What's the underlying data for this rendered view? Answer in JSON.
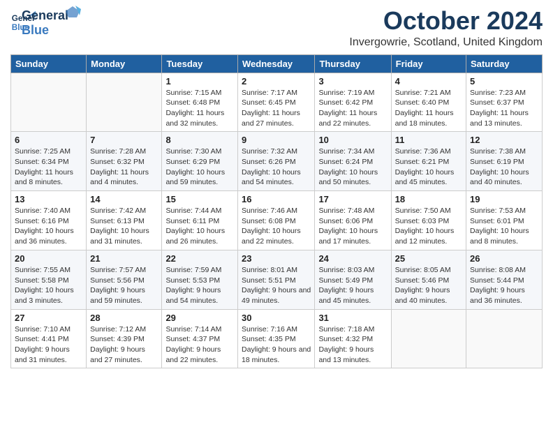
{
  "header": {
    "logo_line1": "General",
    "logo_line2": "Blue",
    "month_title": "October 2024",
    "location": "Invergowrie, Scotland, United Kingdom"
  },
  "weekdays": [
    "Sunday",
    "Monday",
    "Tuesday",
    "Wednesday",
    "Thursday",
    "Friday",
    "Saturday"
  ],
  "weeks": [
    [
      {
        "day": "",
        "info": ""
      },
      {
        "day": "",
        "info": ""
      },
      {
        "day": "1",
        "info": "Sunrise: 7:15 AM\nSunset: 6:48 PM\nDaylight: 11 hours and 32 minutes."
      },
      {
        "day": "2",
        "info": "Sunrise: 7:17 AM\nSunset: 6:45 PM\nDaylight: 11 hours and 27 minutes."
      },
      {
        "day": "3",
        "info": "Sunrise: 7:19 AM\nSunset: 6:42 PM\nDaylight: 11 hours and 22 minutes."
      },
      {
        "day": "4",
        "info": "Sunrise: 7:21 AM\nSunset: 6:40 PM\nDaylight: 11 hours and 18 minutes."
      },
      {
        "day": "5",
        "info": "Sunrise: 7:23 AM\nSunset: 6:37 PM\nDaylight: 11 hours and 13 minutes."
      }
    ],
    [
      {
        "day": "6",
        "info": "Sunrise: 7:25 AM\nSunset: 6:34 PM\nDaylight: 11 hours and 8 minutes."
      },
      {
        "day": "7",
        "info": "Sunrise: 7:28 AM\nSunset: 6:32 PM\nDaylight: 11 hours and 4 minutes."
      },
      {
        "day": "8",
        "info": "Sunrise: 7:30 AM\nSunset: 6:29 PM\nDaylight: 10 hours and 59 minutes."
      },
      {
        "day": "9",
        "info": "Sunrise: 7:32 AM\nSunset: 6:26 PM\nDaylight: 10 hours and 54 minutes."
      },
      {
        "day": "10",
        "info": "Sunrise: 7:34 AM\nSunset: 6:24 PM\nDaylight: 10 hours and 50 minutes."
      },
      {
        "day": "11",
        "info": "Sunrise: 7:36 AM\nSunset: 6:21 PM\nDaylight: 10 hours and 45 minutes."
      },
      {
        "day": "12",
        "info": "Sunrise: 7:38 AM\nSunset: 6:19 PM\nDaylight: 10 hours and 40 minutes."
      }
    ],
    [
      {
        "day": "13",
        "info": "Sunrise: 7:40 AM\nSunset: 6:16 PM\nDaylight: 10 hours and 36 minutes."
      },
      {
        "day": "14",
        "info": "Sunrise: 7:42 AM\nSunset: 6:13 PM\nDaylight: 10 hours and 31 minutes."
      },
      {
        "day": "15",
        "info": "Sunrise: 7:44 AM\nSunset: 6:11 PM\nDaylight: 10 hours and 26 minutes."
      },
      {
        "day": "16",
        "info": "Sunrise: 7:46 AM\nSunset: 6:08 PM\nDaylight: 10 hours and 22 minutes."
      },
      {
        "day": "17",
        "info": "Sunrise: 7:48 AM\nSunset: 6:06 PM\nDaylight: 10 hours and 17 minutes."
      },
      {
        "day": "18",
        "info": "Sunrise: 7:50 AM\nSunset: 6:03 PM\nDaylight: 10 hours and 12 minutes."
      },
      {
        "day": "19",
        "info": "Sunrise: 7:53 AM\nSunset: 6:01 PM\nDaylight: 10 hours and 8 minutes."
      }
    ],
    [
      {
        "day": "20",
        "info": "Sunrise: 7:55 AM\nSunset: 5:58 PM\nDaylight: 10 hours and 3 minutes."
      },
      {
        "day": "21",
        "info": "Sunrise: 7:57 AM\nSunset: 5:56 PM\nDaylight: 9 hours and 59 minutes."
      },
      {
        "day": "22",
        "info": "Sunrise: 7:59 AM\nSunset: 5:53 PM\nDaylight: 9 hours and 54 minutes."
      },
      {
        "day": "23",
        "info": "Sunrise: 8:01 AM\nSunset: 5:51 PM\nDaylight: 9 hours and 49 minutes."
      },
      {
        "day": "24",
        "info": "Sunrise: 8:03 AM\nSunset: 5:49 PM\nDaylight: 9 hours and 45 minutes."
      },
      {
        "day": "25",
        "info": "Sunrise: 8:05 AM\nSunset: 5:46 PM\nDaylight: 9 hours and 40 minutes."
      },
      {
        "day": "26",
        "info": "Sunrise: 8:08 AM\nSunset: 5:44 PM\nDaylight: 9 hours and 36 minutes."
      }
    ],
    [
      {
        "day": "27",
        "info": "Sunrise: 7:10 AM\nSunset: 4:41 PM\nDaylight: 9 hours and 31 minutes."
      },
      {
        "day": "28",
        "info": "Sunrise: 7:12 AM\nSunset: 4:39 PM\nDaylight: 9 hours and 27 minutes."
      },
      {
        "day": "29",
        "info": "Sunrise: 7:14 AM\nSunset: 4:37 PM\nDaylight: 9 hours and 22 minutes."
      },
      {
        "day": "30",
        "info": "Sunrise: 7:16 AM\nSunset: 4:35 PM\nDaylight: 9 hours and 18 minutes."
      },
      {
        "day": "31",
        "info": "Sunrise: 7:18 AM\nSunset: 4:32 PM\nDaylight: 9 hours and 13 minutes."
      },
      {
        "day": "",
        "info": ""
      },
      {
        "day": "",
        "info": ""
      }
    ]
  ]
}
